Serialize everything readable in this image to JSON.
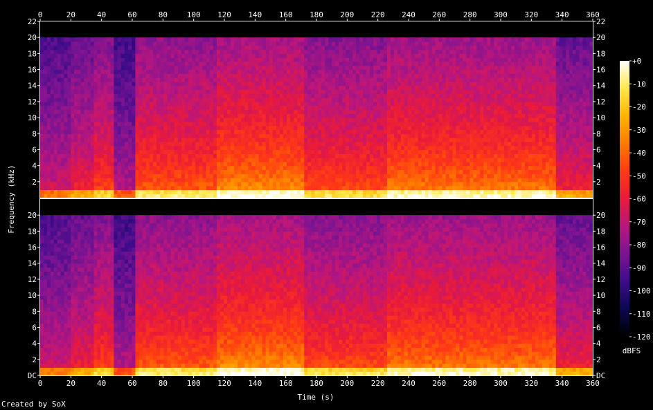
{
  "chart_data": {
    "type": "heatmap",
    "title": "",
    "xlabel": "Time (s)",
    "ylabel": "Frequency (kHz)",
    "xlim": [
      0,
      360
    ],
    "x_ticks": [
      0,
      20,
      40,
      60,
      80,
      100,
      120,
      140,
      160,
      180,
      200,
      220,
      240,
      260,
      280,
      300,
      320,
      340,
      360
    ],
    "channels": [
      {
        "name": "",
        "ylim": [
          0,
          22
        ],
        "y_ticks": [
          "2",
          "4",
          "6",
          "8",
          "10",
          "12",
          "14",
          "16",
          "18",
          "20",
          "22"
        ],
        "y_ticks_right": [
          "2",
          "4",
          "6",
          "8",
          "10",
          "12",
          "14",
          "16",
          "18",
          "20",
          "22"
        ]
      },
      {
        "name": "",
        "ylim": [
          0,
          22
        ],
        "y_ticks": [
          "DC",
          "2",
          "4",
          "6",
          "8",
          "10",
          "12",
          "14",
          "16",
          "18",
          "20"
        ],
        "y_ticks_right": [
          "DC",
          "2",
          "4",
          "6",
          "8",
          "10",
          "12",
          "14",
          "16",
          "18",
          "20"
        ]
      }
    ],
    "content_cutoff_khz": 20,
    "segments": [
      {
        "start": 0,
        "end": 20,
        "energy": 0.3
      },
      {
        "start": 20,
        "end": 35,
        "energy": 0.42
      },
      {
        "start": 35,
        "end": 48,
        "energy": 0.55
      },
      {
        "start": 48,
        "end": 62,
        "energy": 0.22
      },
      {
        "start": 62,
        "end": 115,
        "energy": 0.62
      },
      {
        "start": 115,
        "end": 172,
        "energy": 0.75
      },
      {
        "start": 172,
        "end": 226,
        "energy": 0.58
      },
      {
        "start": 226,
        "end": 336,
        "energy": 0.7
      },
      {
        "start": 336,
        "end": 360,
        "energy": 0.42
      }
    ],
    "colorbar": {
      "label": "dBFS",
      "range": [
        -120,
        0
      ],
      "ticks": [
        "+0",
        "-10",
        "-20",
        "-30",
        "-40",
        "-50",
        "-60",
        "-70",
        "-80",
        "-90",
        "-100",
        "-110",
        "-120"
      ]
    },
    "colors": {
      "background": "#000000",
      "text": "#ffffff",
      "palette": [
        "#000000",
        "#0a0850",
        "#3d0c8a",
        "#7a1492",
        "#b8167e",
        "#e81a3c",
        "#ff3a14",
        "#ff7a00",
        "#ffb400",
        "#ffe84a",
        "#ffffff"
      ]
    }
  },
  "footer": {
    "credit": "Created by SoX"
  }
}
